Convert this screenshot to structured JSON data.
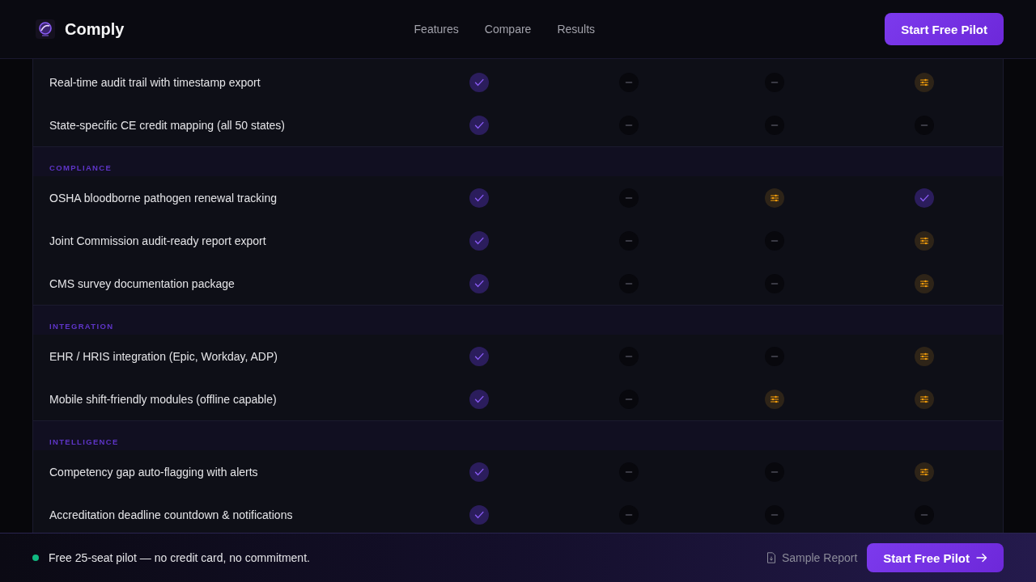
{
  "header": {
    "brand": "Comply",
    "nav": [
      "Features",
      "Compare",
      "Results"
    ],
    "cta": "Start Free Pilot"
  },
  "table": {
    "groups": [
      {
        "rows": [
          {
            "feature": "Real-time audit trail with timestamp export",
            "cells": [
              {
                "kind": "check"
              },
              {
                "kind": "dash"
              },
              {
                "kind": "dash"
              },
              {
                "kind": "partial"
              }
            ]
          },
          {
            "feature": "State-specific CE credit mapping (all 50 states)",
            "cells": [
              {
                "kind": "check"
              },
              {
                "kind": "dash"
              },
              {
                "kind": "dash"
              },
              {
                "kind": "dash"
              }
            ]
          }
        ]
      },
      {
        "label": "COMPLIANCE",
        "rows": [
          {
            "feature": "OSHA bloodborne pathogen renewal tracking",
            "cells": [
              {
                "kind": "check"
              },
              {
                "kind": "dash"
              },
              {
                "kind": "partial"
              },
              {
                "kind": "check"
              }
            ]
          },
          {
            "feature": "Joint Commission audit-ready report export",
            "cells": [
              {
                "kind": "check"
              },
              {
                "kind": "dash"
              },
              {
                "kind": "dash"
              },
              {
                "kind": "partial"
              }
            ]
          },
          {
            "feature": "CMS survey documentation package",
            "cells": [
              {
                "kind": "check"
              },
              {
                "kind": "dash"
              },
              {
                "kind": "dash"
              },
              {
                "kind": "partial"
              }
            ]
          }
        ]
      },
      {
        "label": "INTEGRATION",
        "rows": [
          {
            "feature": "EHR / HRIS integration (Epic, Workday, ADP)",
            "cells": [
              {
                "kind": "check"
              },
              {
                "kind": "dash"
              },
              {
                "kind": "dash"
              },
              {
                "kind": "partial"
              }
            ]
          },
          {
            "feature": "Mobile shift-friendly modules (offline capable)",
            "cells": [
              {
                "kind": "check"
              },
              {
                "kind": "dash"
              },
              {
                "kind": "partial"
              },
              {
                "kind": "partial"
              }
            ]
          }
        ]
      },
      {
        "label": "INTELLIGENCE",
        "rows": [
          {
            "feature": "Competency gap auto-flagging with alerts",
            "cells": [
              {
                "kind": "check"
              },
              {
                "kind": "dash"
              },
              {
                "kind": "dash"
              },
              {
                "kind": "partial"
              }
            ]
          },
          {
            "feature": "Accreditation deadline countdown & notifications",
            "cells": [
              {
                "kind": "check"
              },
              {
                "kind": "dash"
              },
              {
                "kind": "dash"
              },
              {
                "kind": "dash"
              }
            ]
          }
        ]
      }
    ]
  },
  "bottom_bar": {
    "message": "Free 25-seat pilot — no credit card, no commitment.",
    "link": "Sample Report",
    "cta": "Start Free Pilot"
  }
}
